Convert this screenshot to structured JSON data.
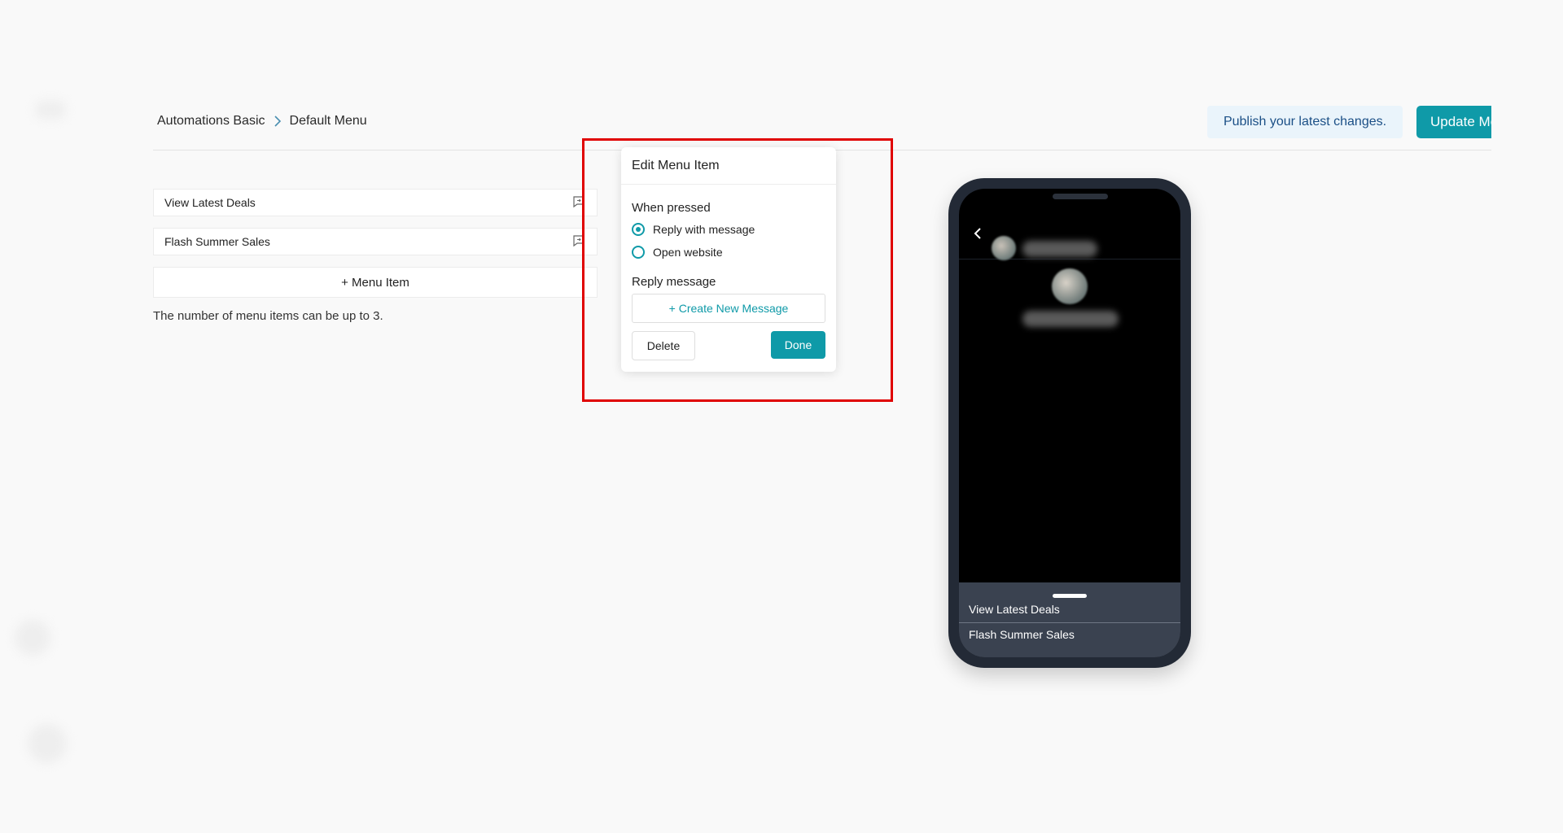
{
  "header": {
    "breadcrumb": [
      "Automations Basic",
      "Default Menu"
    ],
    "publish_note": "Publish your latest changes.",
    "update_button": "Update Me"
  },
  "menu_items": [
    {
      "label": "View Latest Deals",
      "icon": "reply-message-icon"
    },
    {
      "label": "Flash Summer Sales",
      "icon": "reply-message-icon"
    }
  ],
  "add_item_label": "+ Menu Item",
  "hint": "The number of menu items can be up to 3.",
  "popover": {
    "title": "Edit Menu Item",
    "when_pressed_label": "When pressed",
    "options": [
      {
        "label": "Reply with message",
        "selected": true
      },
      {
        "label": "Open website",
        "selected": false
      }
    ],
    "reply_label": "Reply message",
    "create_message": "+ Create New Message",
    "delete": "Delete",
    "done": "Done"
  },
  "phone_preview": {
    "menu": [
      "View Latest Deals",
      "Flash Summer Sales"
    ]
  },
  "colors": {
    "accent": "#0f9aa8",
    "highlight": "#e00000",
    "phone_frame": "#232a36"
  }
}
